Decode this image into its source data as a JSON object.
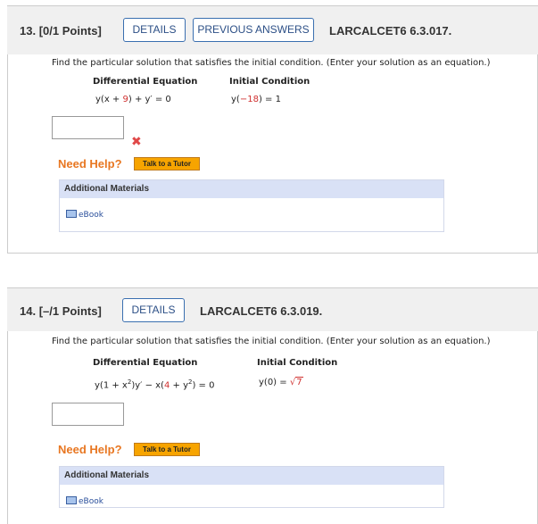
{
  "q13": {
    "number": "13.",
    "points": "[0/1 Points]",
    "details_label": "DETAILS",
    "previous_label": "PREVIOUS ANSWERS",
    "problem_id": "LARCALCET6 6.3.017.",
    "prompt": "Find the particular solution that satisfies the initial condition. (Enter your solution as an equation.)",
    "col_de": "Differential Equation",
    "col_ic": "Initial Condition",
    "de_a": "y(x + ",
    "de_b": "9",
    "de_c": ") + y′ = 0",
    "ic_a": "y(",
    "ic_b": "−18",
    "ic_c": ") = 1",
    "answer": "",
    "wrong_mark": "✖",
    "need_help": "Need Help?",
    "tutor": "Talk to a Tutor",
    "additional_materials": "Additional Materials",
    "ebook": "eBook"
  },
  "q14": {
    "number": "14.",
    "points": "[–/1 Points]",
    "details_label": "DETAILS",
    "problem_id": "LARCALCET6 6.3.019.",
    "prompt": "Find the particular solution that satisfies the initial condition. (Enter your solution as an equation.)",
    "col_de": "Differential Equation",
    "col_ic": "Initial Condition",
    "de_a": "y(1 + x",
    "de_b": "2",
    "de_c": ")y′ − x(",
    "de_d": "4",
    "de_e": " + y",
    "de_f": "2",
    "de_g": ") = 0",
    "ic_a": "y(0) = ",
    "ic_sqrt": "√",
    "ic_rad": "7",
    "answer": "",
    "need_help": "Need Help?",
    "tutor": "Talk to a Tutor",
    "additional_materials": "Additional Materials",
    "ebook": "eBook"
  },
  "colors": {
    "accent": "#3a6fb0",
    "help": "#e87722",
    "tutor": "#f7a400",
    "error": "#e04848",
    "value_red": "#d0302f",
    "materials_head": "#d9e1f6"
  }
}
